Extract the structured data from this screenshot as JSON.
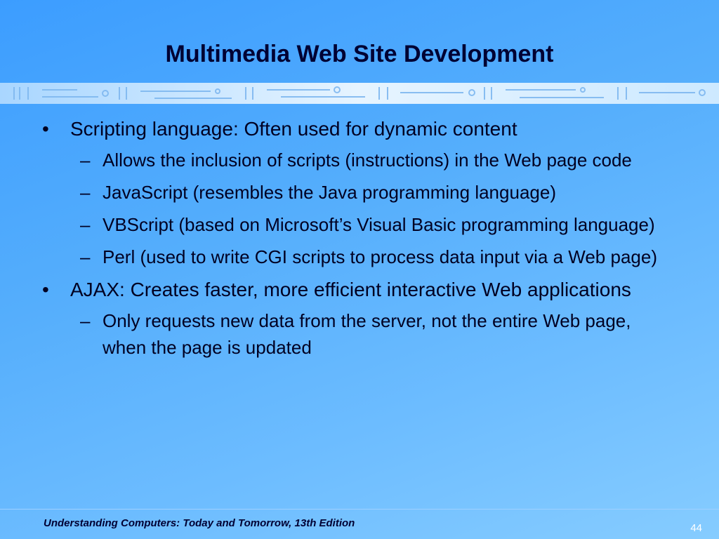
{
  "slide": {
    "title": "Multimedia Web Site Development"
  },
  "content": {
    "items": [
      {
        "text": "Scripting language: Often used for dynamic content",
        "marker": "•"
      },
      {
        "text": "Allows the inclusion of scripts (instructions) in the Web page code",
        "marker": "–"
      },
      {
        "text": "JavaScript (resembles the Java programming language)",
        "marker": "–"
      },
      {
        "text": "VBScript (based on Microsoft’s Visual Basic programming language)",
        "marker": "–"
      },
      {
        "text": "Perl (used to write CGI scripts to process data input via a Web page)",
        "marker": "–"
      },
      {
        "text": "AJAX: Creates faster, more efficient interactive Web applications",
        "marker": "•"
      },
      {
        "text": "Only requests new data from the server, not the entire Web page, when the page is updated",
        "marker": "–"
      }
    ]
  },
  "footer": {
    "book_title": "Understanding Computers: Today and Tomorrow, 13th Edition",
    "page_number": "44"
  },
  "colors": {
    "background_start": "#3c9dff",
    "background_end": "#86ccff",
    "title_text": "#000033",
    "page_number_text": "#ffffff"
  }
}
